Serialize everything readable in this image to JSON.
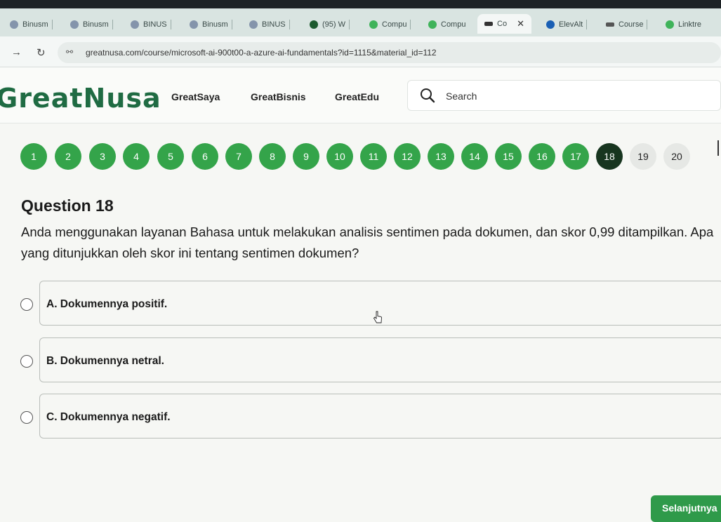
{
  "browser": {
    "tabs": [
      {
        "label": "Binusm",
        "icon": "binus-icon",
        "color": "#5b6f8a"
      },
      {
        "label": "Binusm",
        "icon": "binus-icon",
        "color": "#5b6f8a"
      },
      {
        "label": "BINUS",
        "icon": "binus-icon",
        "color": "#5b6f8a"
      },
      {
        "label": "Binusm",
        "icon": "binus-icon",
        "color": "#5b6f8a"
      },
      {
        "label": "BINUS",
        "icon": "binus-icon",
        "color": "#5b6f8a"
      },
      {
        "label": "(95) W",
        "icon": "whatsapp-icon",
        "color": "#1c8a3c"
      },
      {
        "label": "Compu",
        "icon": "compu-icon",
        "color": "#2ca04a"
      },
      {
        "label": "Compu",
        "icon": "compu-icon",
        "color": "#2ca04a"
      },
      {
        "label": "Co",
        "icon": "greatnusa-icon",
        "color": "#333333",
        "active": true
      },
      {
        "label": "ElevAlt",
        "icon": "cloud-icon",
        "color": "#1a5fb4"
      },
      {
        "label": "Course",
        "icon": "greatnusa-icon",
        "color": "#555555"
      },
      {
        "label": "Linktre",
        "icon": "linktree-icon",
        "color": "#2ca04a"
      }
    ],
    "url": "greatnusa.com/course/microsoft-ai-900t00-a-azure-ai-fundamentals?id=1115&material_id=112"
  },
  "header": {
    "logo": "GreatNusa",
    "nav": [
      "GreatSaya",
      "GreatBisnis",
      "GreatEdu"
    ],
    "search_placeholder": "Search"
  },
  "pager": {
    "numbers": [
      "1",
      "2",
      "3",
      "4",
      "5",
      "6",
      "7",
      "8",
      "9",
      "10",
      "11",
      "12",
      "13",
      "14",
      "15",
      "16",
      "17",
      "18",
      "19",
      "20"
    ],
    "current": "18",
    "answered_color": "#34a44a",
    "current_color": "#17351f"
  },
  "question": {
    "title": "Question 18",
    "text": "Anda menggunakan layanan Bahasa untuk melakukan analisis sentimen pada dokumen, dan skor 0,99 ditampilkan. Apa yang ditunjukkan oleh skor ini tentang sentimen dokumen?",
    "options": [
      {
        "label": "A. Dokumennya positif."
      },
      {
        "label": "B. Dokumennya netral."
      },
      {
        "label": "C. Dokumennya negatif."
      }
    ]
  },
  "footer": {
    "next_label": "Selanjutnya"
  }
}
